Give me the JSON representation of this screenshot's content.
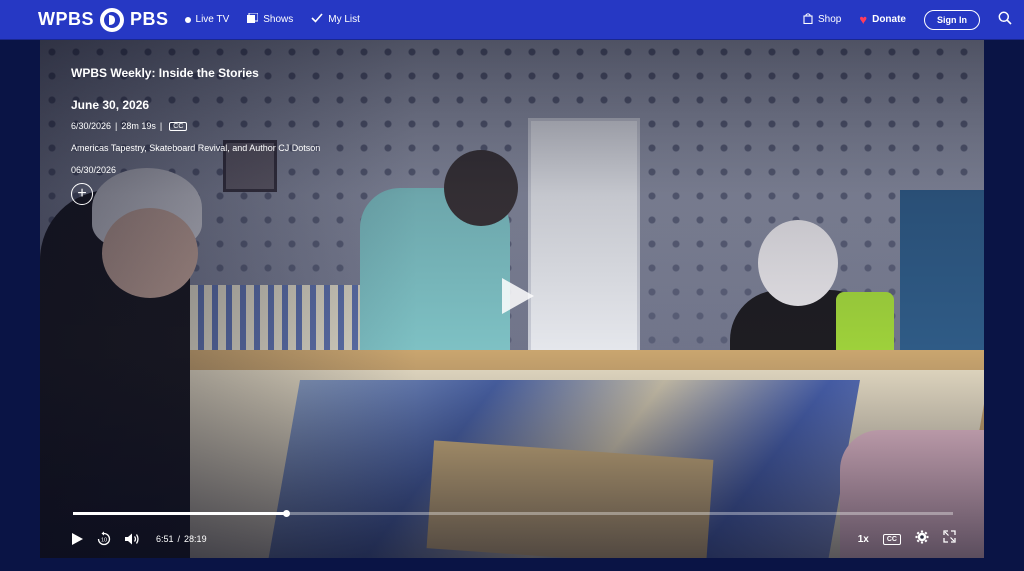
{
  "nav": {
    "logo_text": "WPBS",
    "logo_brand": "PBS",
    "live_tv": "Live TV",
    "shows": "Shows",
    "my_list": "My List",
    "shop": "Shop",
    "donate": "Donate",
    "sign_in": "Sign In",
    "bar_color": "#2638c4"
  },
  "video": {
    "show_title": "WPBS Weekly: Inside the Stories",
    "episode_title": "June 30, 2026",
    "meta_date": "6/30/2026",
    "meta_sep": "|",
    "duration": "28m 19s",
    "meta_sep2": "|",
    "cc_badge": "CC",
    "description": "Americas Tapestry, Skateboard Revival, and Author CJ Dotson",
    "air_date": "06/30/2026",
    "add_label": "+"
  },
  "player": {
    "current_time": "6:51",
    "time_sep": "/",
    "total_time": "28:19",
    "progress_fraction": 0.242,
    "speed": "1x",
    "cc_label": "CC"
  },
  "icons": [
    "play-icon",
    "replay-10-icon",
    "volume-icon",
    "settings-icon",
    "fullscreen-icon",
    "search-icon",
    "shop-bag-icon",
    "heart-icon",
    "shows-icon",
    "checkmark-icon"
  ]
}
